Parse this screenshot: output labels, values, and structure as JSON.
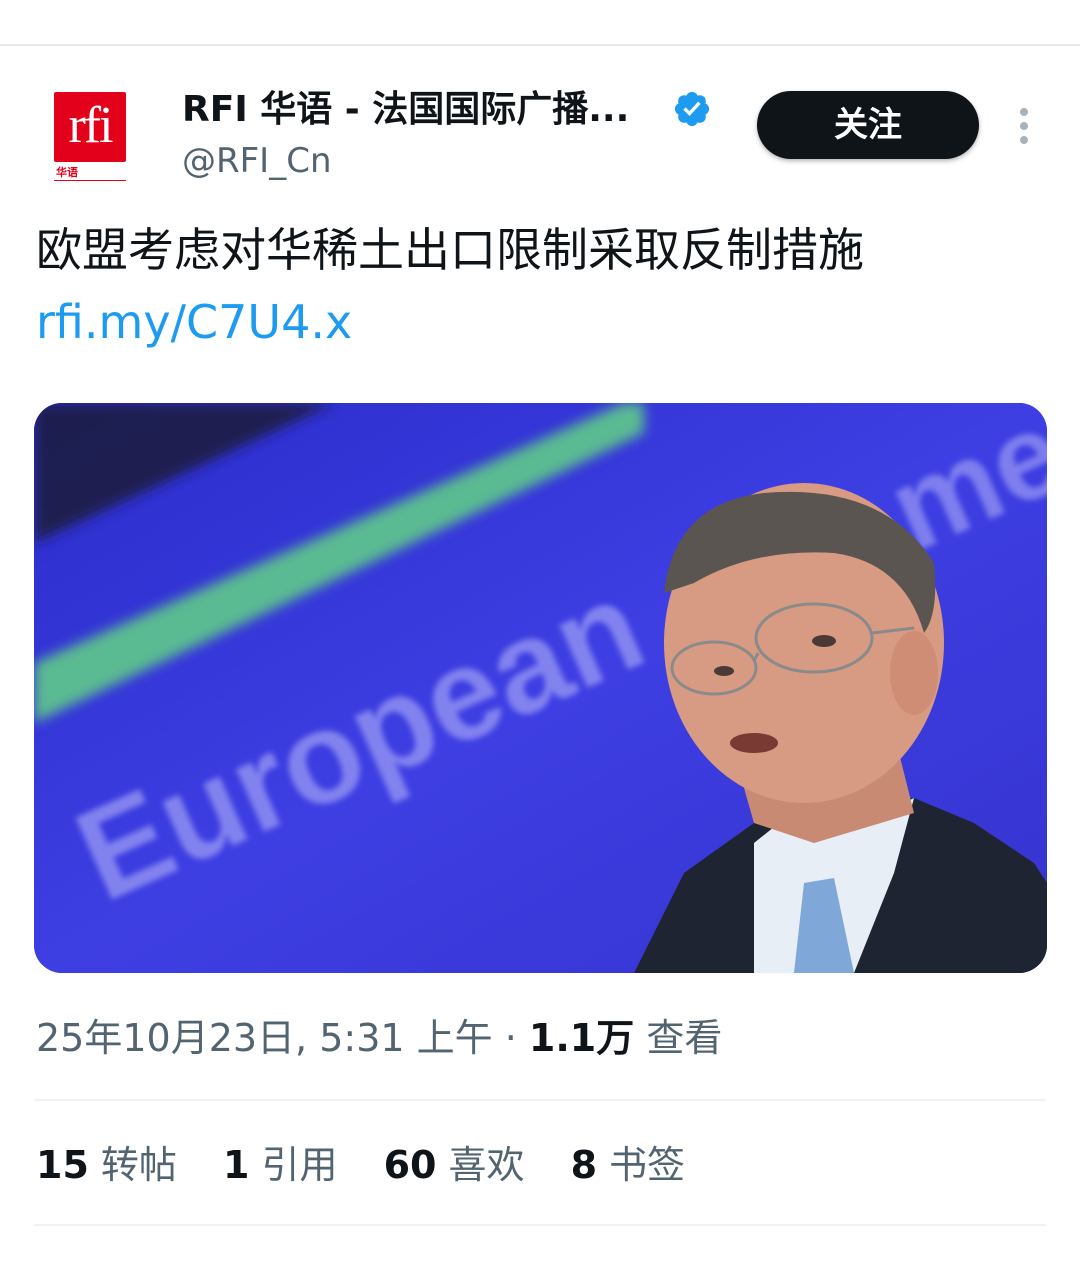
{
  "account": {
    "display_name": "RFI 华语 - 法国国际广播...",
    "handle": "@RFI_Cn",
    "verified": true,
    "avatar_logo_text": "rfi",
    "avatar_logo_sub": "华语",
    "brand_color": "#e3001b"
  },
  "actions": {
    "follow_label": "关注",
    "more_icon": "more-vertical-icon"
  },
  "tweet": {
    "text": "欧盟考虑对华稀土出口限制采取反制措施",
    "link": "rfi.my/C7U4.x",
    "link_color": "#1d9bf0",
    "media": {
      "backdrop_text": "European",
      "backdrop_text_tail": "me"
    }
  },
  "meta": {
    "timestamp": "25年10月23日, 5:31 上午",
    "separator": "·",
    "views_count": "1.1万",
    "views_label": "查看"
  },
  "stats": [
    {
      "count": "15",
      "label": "转帖"
    },
    {
      "count": "1",
      "label": "引用"
    },
    {
      "count": "60",
      "label": "喜欢"
    },
    {
      "count": "8",
      "label": "书签"
    }
  ],
  "colors": {
    "text_primary": "#0f1419",
    "text_secondary": "#536471",
    "verified_blue": "#1d9bf0"
  }
}
